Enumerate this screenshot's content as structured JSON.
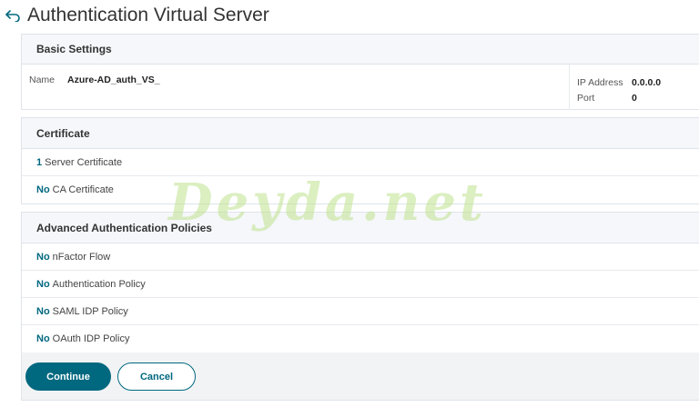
{
  "header": {
    "title": "Authentication Virtual Server",
    "back_icon": "back-arrow-icon"
  },
  "basic_settings": {
    "title": "Basic Settings",
    "name_label": "Name",
    "name_value": "Azure-AD_auth_VS_",
    "ip_label": "IP Address",
    "ip_value": "0.0.0.0",
    "port_label": "Port",
    "port_value": "0"
  },
  "certificate": {
    "title": "Certificate",
    "rows": [
      {
        "count": "1",
        "label": "Server Certificate"
      },
      {
        "count": "No",
        "label": "CA Certificate"
      }
    ]
  },
  "advanced": {
    "title": "Advanced Authentication Policies",
    "rows": [
      {
        "count": "No",
        "label": "nFactor Flow"
      },
      {
        "count": "No",
        "label": "Authentication Policy"
      },
      {
        "count": "No",
        "label": "SAML IDP Policy"
      },
      {
        "count": "No",
        "label": "OAuth IDP Policy"
      }
    ]
  },
  "buttons": {
    "continue": "Continue",
    "cancel": "Cancel"
  },
  "watermark": "Deyda.net",
  "colors": {
    "accent": "#00687f",
    "panel_header_bg": "#f5f7fa",
    "border": "#dfe4ea"
  }
}
